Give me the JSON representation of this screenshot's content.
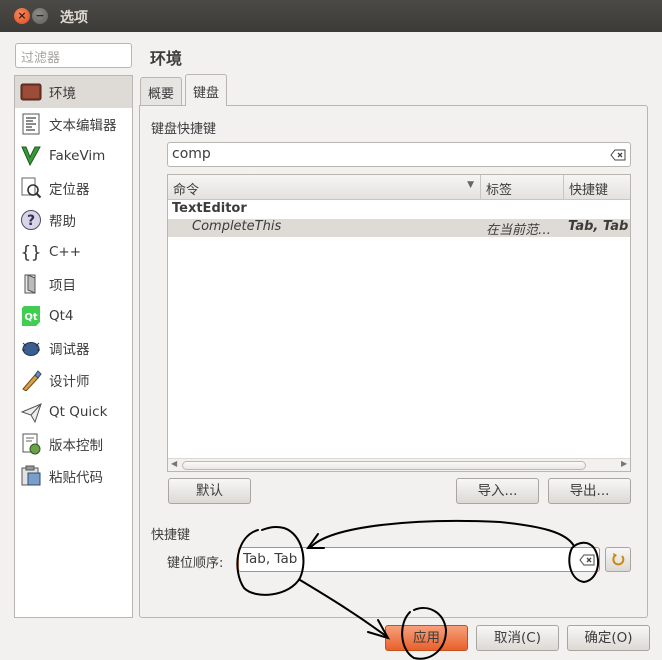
{
  "window": {
    "title": "选项",
    "close_glyph": "×",
    "minimize_glyph": "−"
  },
  "filter": {
    "placeholder": "过滤器"
  },
  "sidebar": {
    "items": [
      {
        "label": "环境",
        "icon": "environment-icon",
        "selected": true
      },
      {
        "label": "文本编辑器",
        "icon": "text-editor-icon"
      },
      {
        "label": "FakeVim",
        "icon": "fakevim-icon"
      },
      {
        "label": "定位器",
        "icon": "locator-icon"
      },
      {
        "label": "帮助",
        "icon": "help-icon"
      },
      {
        "label": "C++",
        "icon": "cpp-icon"
      },
      {
        "label": "项目",
        "icon": "project-icon"
      },
      {
        "label": "Qt4",
        "icon": "qt4-icon"
      },
      {
        "label": "调试器",
        "icon": "debugger-icon"
      },
      {
        "label": "设计师",
        "icon": "designer-icon"
      },
      {
        "label": "Qt Quick",
        "icon": "qt-quick-icon"
      },
      {
        "label": "版本控制",
        "icon": "version-control-icon"
      },
      {
        "label": "粘贴代码",
        "icon": "code-paste-icon"
      }
    ]
  },
  "page": {
    "title": "环境",
    "tabs": [
      {
        "label": "概要"
      },
      {
        "label": "键盘",
        "active": true
      }
    ]
  },
  "keyboard": {
    "section_label": "键盘快捷键",
    "search_value": "comp",
    "columns": [
      "命令",
      "标签",
      "快捷键"
    ],
    "rows": [
      {
        "command": "TextEditor",
        "label": "",
        "shortcut": "",
        "group": true
      },
      {
        "command": "CompleteThis",
        "label": "在当前范…",
        "shortcut": "Tab, Tab",
        "selected": true
      }
    ],
    "default_button": "默认",
    "import_button": "导入...",
    "export_button": "导出..."
  },
  "shortcut": {
    "section_label": "快捷键",
    "sequence_label": "键位顺序:",
    "sequence_value": "Tab, Tab"
  },
  "footer": {
    "apply": "应用",
    "cancel": "取消(C)",
    "ok": "确定(O)"
  },
  "colors": {
    "accent": "#e9602b",
    "selection": "#dedbd6"
  }
}
